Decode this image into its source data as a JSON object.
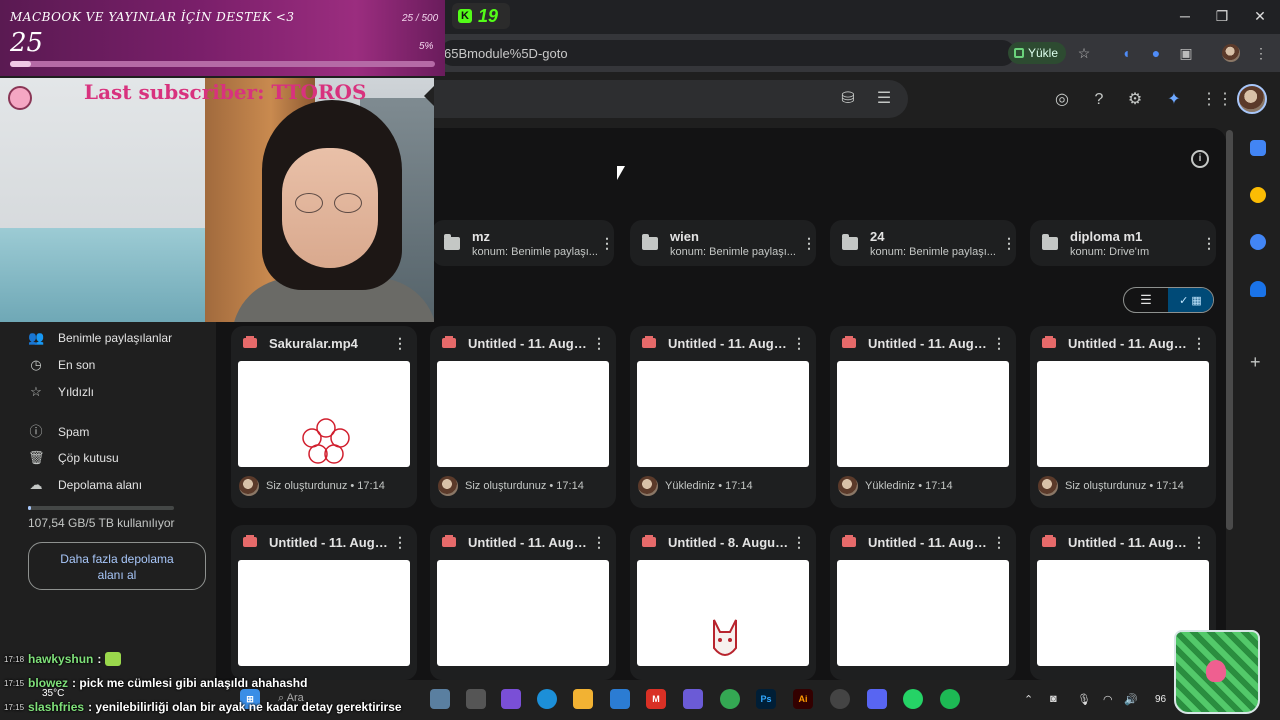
{
  "browser": {
    "kick_extension_count": "19",
    "url_fragment": "65Bmodule%5D-goto",
    "upload_label": "Yükle",
    "window_controls": [
      "─",
      "❐",
      "✕"
    ]
  },
  "drive": {
    "folders": [
      {
        "name": "mz",
        "location": "konum: Benimle paylaşı..."
      },
      {
        "name": "wien",
        "location": "konum: Benimle paylaşı..."
      },
      {
        "name": "24",
        "location": "konum: Benimle paylaşı..."
      },
      {
        "name": "diploma m1",
        "location": "konum: Drive'ım"
      }
    ],
    "files_row1": [
      {
        "title": "Sakuralar.mp4",
        "meta": "Siz oluşturdunuz • 17:14"
      },
      {
        "title": "Untitled - 11. Augus...",
        "meta": "Siz oluşturdunuz • 17:14"
      },
      {
        "title": "Untitled - 11. Augus...",
        "meta": "Yüklediniz • 17:14"
      },
      {
        "title": "Untitled - 11. Augus...",
        "meta": "Yüklediniz • 17:14"
      },
      {
        "title": "Untitled - 11. Augus...",
        "meta": "Siz oluşturdunuz • 17:14"
      }
    ],
    "files_row2": [
      {
        "title": "Untitled - 11. Augus..."
      },
      {
        "title": "Untitled - 11. Augus..."
      },
      {
        "title": "Untitled - 8. August..."
      },
      {
        "title": "Untitled - 11. Augus..."
      },
      {
        "title": "Untitled - 11. Augus..."
      }
    ],
    "sidebar": {
      "items": [
        {
          "label": "Benimle paylaşılanlar",
          "icon": "people-icon"
        },
        {
          "label": "En son",
          "icon": "clock-icon"
        },
        {
          "label": "Yıldızlı",
          "icon": "star-icon"
        },
        {
          "label": "Spam",
          "icon": "spam-icon"
        },
        {
          "label": "Çöp kutusu",
          "icon": "trash-icon"
        },
        {
          "label": "Depolama alanı",
          "icon": "cloud-icon"
        }
      ],
      "storage_used": "107,54 GB/5 TB kullanılıyor",
      "storage_fraction": 0.021,
      "buy_storage": "Daha fazla depolama alanı al"
    }
  },
  "stream": {
    "goal_title": "MACBOOK VE YAYINLAR İÇİN DESTEK <3",
    "goal_count": "25 / 500",
    "goal_current": "25",
    "goal_percent": "5%",
    "goal_fraction": 0.05,
    "last_subscriber": "Last subscriber: TTOROS",
    "chat": [
      {
        "time": "17:18",
        "user": "hawkyshun",
        "text": ":"
      },
      {
        "time": "17:15",
        "user": "blowez",
        "text": ": pick me cümlesi gibi anlaşıldı ahahashd"
      },
      {
        "time": "17:15",
        "user": "slashfries",
        "text": ": yenilebilirliği olan bir ayak ne kadar detay gerektirirse"
      }
    ],
    "weather": "35°C"
  },
  "taskbar": {
    "search_label": "Ara",
    "tray_text": "96"
  },
  "colors": {
    "drive_bg": "#131314",
    "card_bg": "#1e1f20",
    "accent_blue": "#004a77",
    "video_red": "#e66a6a",
    "goal_purple": "#7a1f6a",
    "sub_pink": "#d8327e"
  }
}
